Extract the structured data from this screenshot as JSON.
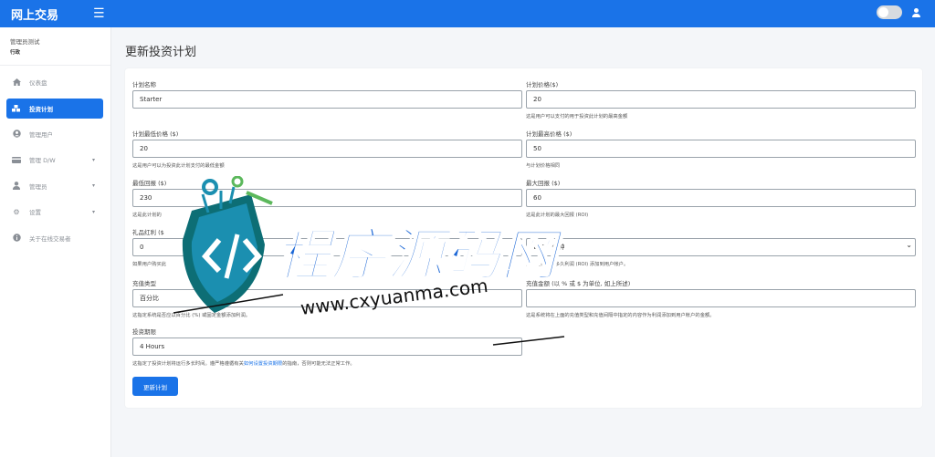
{
  "app": {
    "title": "网上交易"
  },
  "header": {
    "theme_toggle": "off"
  },
  "profile": {
    "name": "管理员测试",
    "role": "行政"
  },
  "sidebar": {
    "items": [
      {
        "icon": "home-icon",
        "label": "仪表盘"
      },
      {
        "icon": "cubes-icon",
        "label": "投资计划"
      },
      {
        "icon": "user-circle-icon",
        "label": "管理用户"
      },
      {
        "icon": "credit-card-icon",
        "label": "管理 D/W"
      },
      {
        "icon": "user-icon",
        "label": "管理员"
      },
      {
        "icon": "gear-icon",
        "label": "设置"
      },
      {
        "icon": "info-icon",
        "label": "关于在线交易者"
      }
    ]
  },
  "page": {
    "title": "更新投资计划"
  },
  "form": {
    "plan_name": {
      "label": "计划名称",
      "value": "Starter"
    },
    "plan_price": {
      "label": "计划价格($)",
      "value": "20",
      "help": "这是用户可以支付的用于投资此计划的最高金额"
    },
    "min_price": {
      "label": "计划最低价格 ($)",
      "value": "20",
      "help": "这是用户可以为投资此计划支付的最低金额"
    },
    "max_price": {
      "label": "计划最高价格 ($)",
      "value": "50",
      "help": "与计划价格相同"
    },
    "min_return": {
      "label": "最低回报 ($)",
      "value": "230",
      "help": "这是此计划的"
    },
    "max_return": {
      "label": "最大回报 ($)",
      "value": "60",
      "help": "这是此计划的最大回报 (ROI)"
    },
    "gift_bonus": {
      "label": "礼品红利 ($",
      "value": "0",
      "help": "如果用户购买此"
    },
    "topup_interval": {
      "label": "充值间隔",
      "value": "每 30 分钟",
      "help": "这指定系统应多久利润 (ROI) 添加到用户帐户。"
    },
    "topup_type": {
      "label": "充值类型",
      "value": "百分比",
      "help": "这指定系统是否应以百分比 (%) 或固定金额添加利润。"
    },
    "topup_amount": {
      "label": "充值金额 (以 % 或 $ 为单位, 如上所述)",
      "value": "",
      "help": "这是系统将在上面的充值类型和充值间隔中指定的内容作为利润添加到用户帐户的金额。"
    },
    "duration": {
      "label": "投资期限",
      "value": "4 Hours",
      "help_before": "这指定了投资计划将运行多长时间。遵严格遵循有关",
      "help_link": "如何设置投资期限",
      "help_after": "的指南，否则可能无法正常工作。"
    },
    "submit_label": "更新计划"
  },
  "watermark": {
    "brand": "程序源码网",
    "url": "www.cxyuanma.com"
  }
}
